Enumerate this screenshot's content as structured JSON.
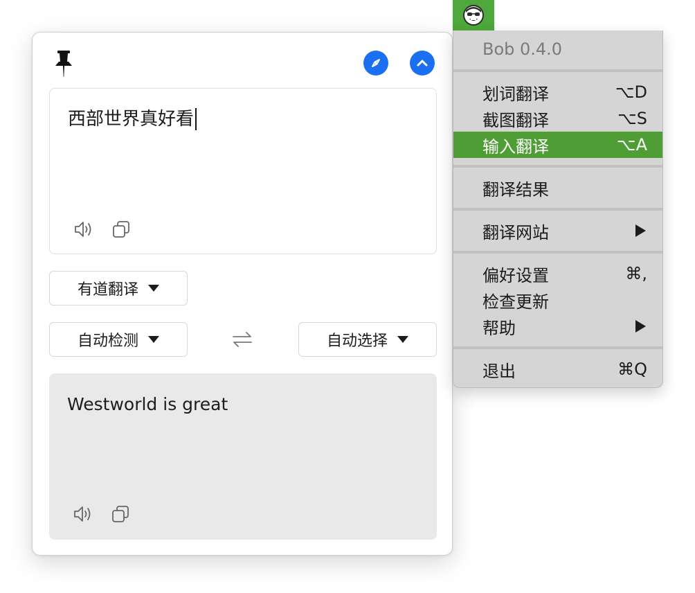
{
  "window": {
    "input_text": "西部世界真好看",
    "engine_label": "有道翻译",
    "source_lang_label": "自动检测",
    "target_lang_label": "自动选择",
    "output_text": "Westworld is great"
  },
  "icons": {
    "pin": "pin-icon",
    "compass": "compass-icon",
    "collapse": "chevron-up-icon",
    "speaker": "speaker-icon",
    "copy": "copy-icon",
    "swap": "swap-arrows-icon",
    "status": "bob-face-icon"
  },
  "colors": {
    "accent_blue": "#1a6ff2",
    "menu_highlight": "#4e9d35",
    "status_item_bg": "#4ea83b",
    "menu_bg": "#d5d5d5",
    "output_bg": "#e9e9e9"
  },
  "menu": {
    "version_label": "Bob 0.4.0",
    "items": [
      {
        "label": "划词翻译",
        "shortcut": "⌥D"
      },
      {
        "label": "截图翻译",
        "shortcut": "⌥S"
      },
      {
        "label": "输入翻译",
        "shortcut": "⌥A"
      },
      {
        "label": "翻译结果",
        "shortcut": ""
      },
      {
        "label": "翻译网站",
        "shortcut": ""
      },
      {
        "label": "偏好设置",
        "shortcut": "⌘,"
      },
      {
        "label": "检查更新",
        "shortcut": ""
      },
      {
        "label": "帮助",
        "shortcut": ""
      },
      {
        "label": "退出",
        "shortcut": "⌘Q"
      }
    ],
    "highlighted_item": "输入翻译"
  }
}
